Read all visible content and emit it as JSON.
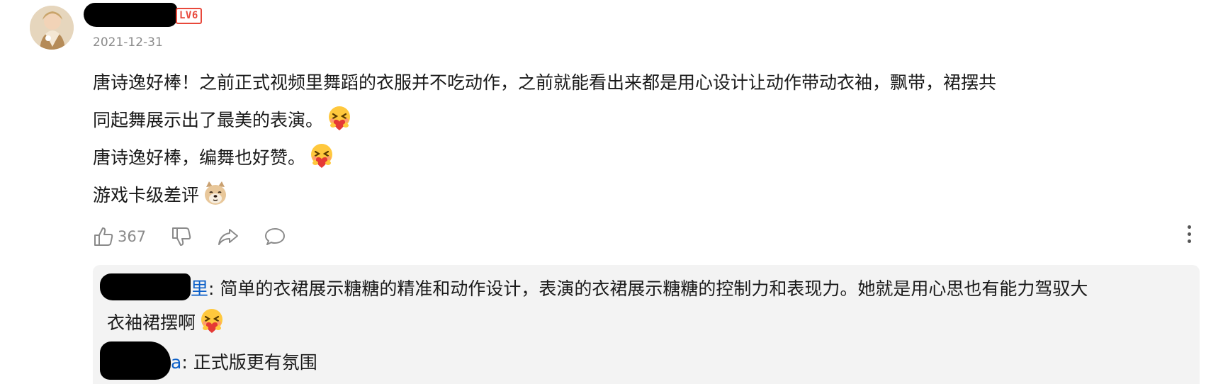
{
  "comment": {
    "level_badge": "LV6",
    "timestamp": "2021-12-31",
    "body_lines": [
      "唐诗逸好棒！之前正式视频里舞蹈的衣服并不吃动作，之前就能看出来都是用心设计让动作带动衣袖，飘带，裙摆共",
      "同起舞展示出了最美的表演。",
      "唐诗逸好棒，编舞也好赞。",
      "游戏卡级差评"
    ],
    "emojis": [
      "hug-heart-emoji",
      "hug-heart-emoji",
      "doge-emoji"
    ],
    "actions": {
      "like_count": "367"
    }
  },
  "replies": [
    {
      "name_tail": "里",
      "text_line1": ": 简单的衣裙展示糖糖的精准和动作设计，表演的衣裙展示糖糖的控制力和表现力。她就是用心思也有能力驾驭大",
      "text_line2": "衣袖裙摆啊"
    },
    {
      "name_tail": "a",
      "text": ": 正式版更有氛围"
    }
  ],
  "colors": {
    "level_badge": "#e8483b",
    "muted_text": "#8a8a8a",
    "reply_bg": "#f3f3f3",
    "reply_name": "#0b5fc8"
  }
}
